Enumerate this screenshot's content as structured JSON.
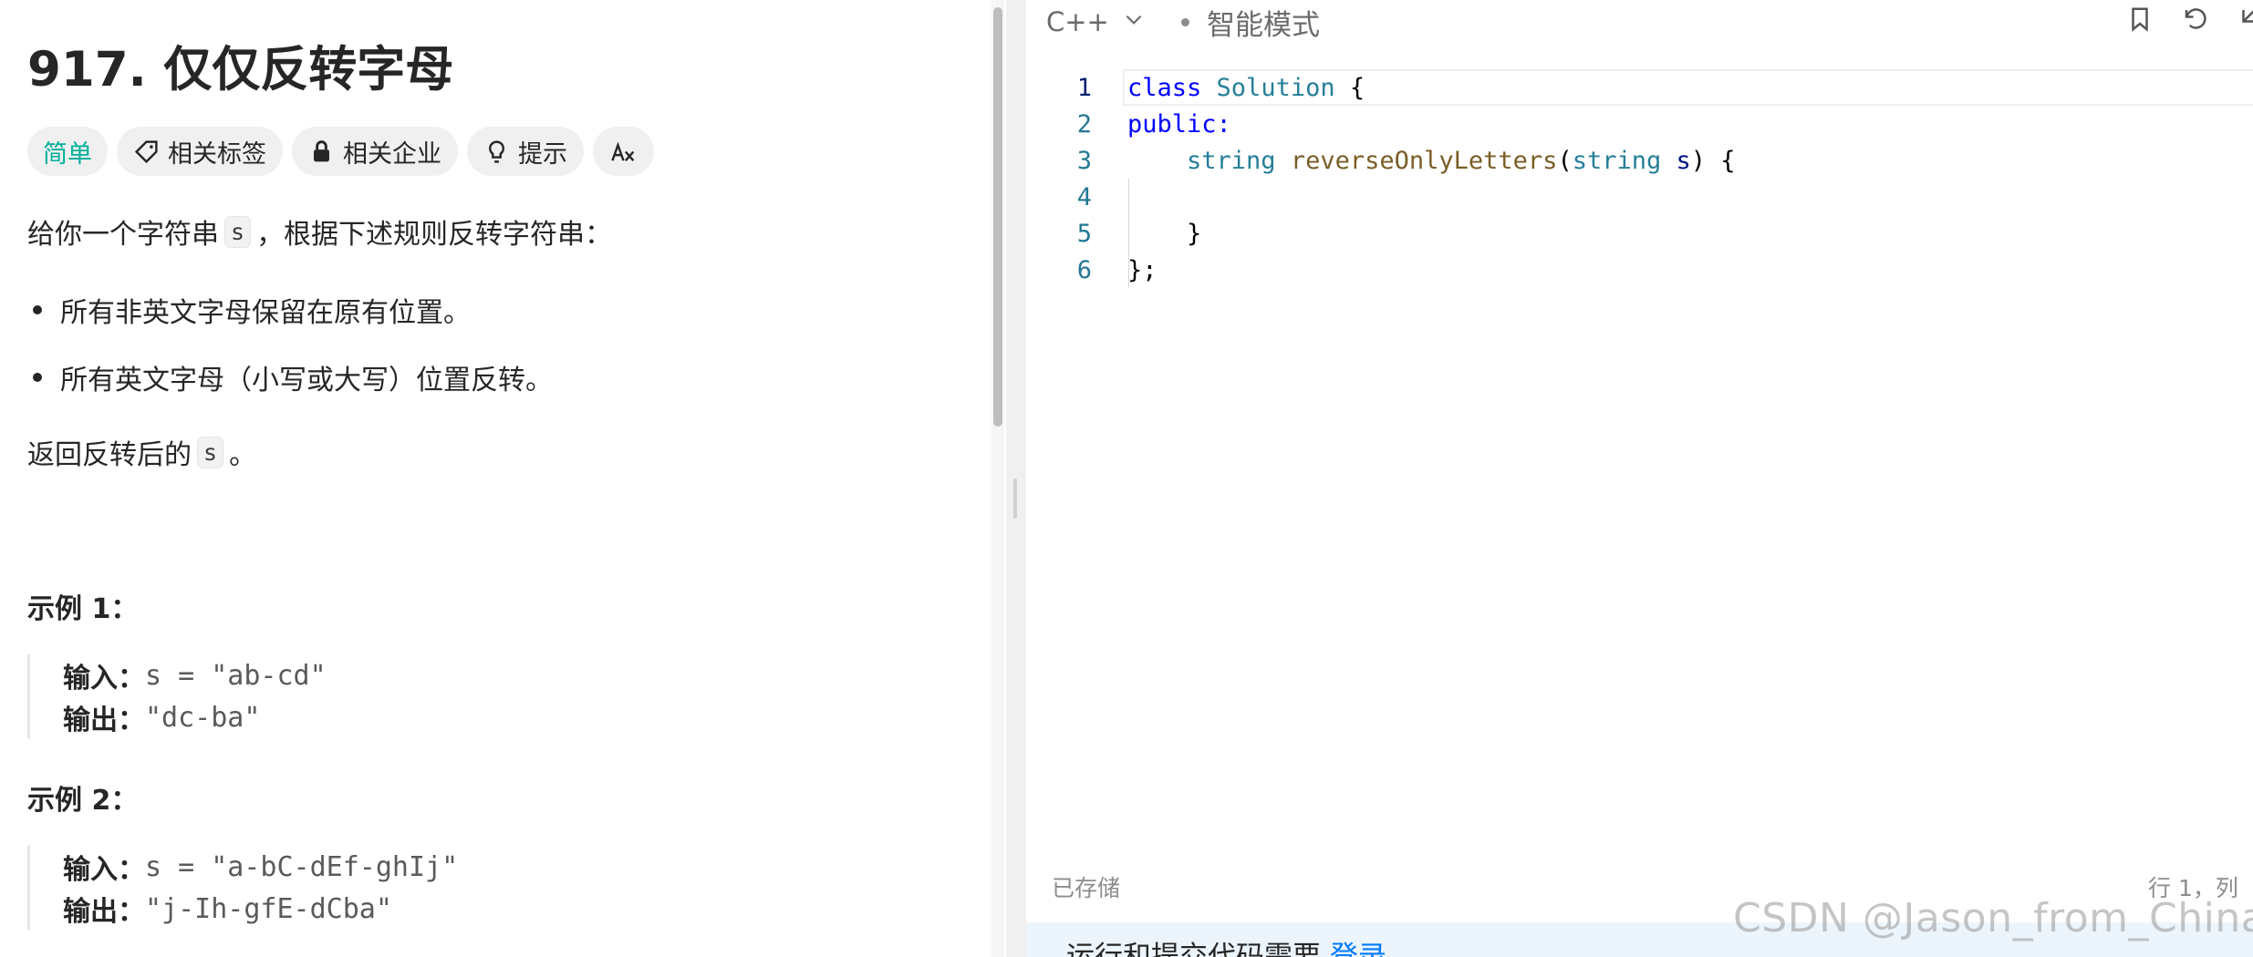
{
  "problem": {
    "title": "917. 仅仅反转字母",
    "tags": {
      "difficulty": "简单",
      "topics": "相关标签",
      "companies": "相关企业",
      "hint": "提示"
    },
    "description": {
      "p1_before": "给你一个字符串",
      "p1_code": "s",
      "p1_after": "，根据下述规则反转字符串：",
      "bullets": [
        "所有非英文字母保留在原有位置。",
        "所有英文字母（小写或大写）位置反转。"
      ],
      "p2_before": "返回反转后的",
      "p2_code": "s",
      "p2_after": "。"
    },
    "examples": [
      {
        "title": "示例 1：",
        "input_label": "输入：",
        "input": "s = \"ab-cd\"",
        "output_label": "输出：",
        "output": "\"dc-ba\""
      },
      {
        "title": "示例 2：",
        "input_label": "输入：",
        "input": "s = \"a-bC-dEf-ghIj\"",
        "output_label": "输出：",
        "output": "\"j-Ih-gfE-dCba\""
      }
    ]
  },
  "editor": {
    "language": "C++",
    "mode": "智能模式",
    "line_numbers": [
      "1",
      "2",
      "3",
      "4",
      "5",
      "6"
    ],
    "code": {
      "l1_kw": "class",
      "l1_ty": "Solution",
      "l1_rest": " {",
      "l2_kw": "public:",
      "l3_ty": "string",
      "l3_fn": "reverseOnlyLetters",
      "l3_p1": "(",
      "l3_ty2": "string",
      "l3_pm": "s",
      "l3_rest": ") {",
      "l5": "}",
      "l6": "};"
    },
    "status_saved": "已存储",
    "cursor_position": "行 1，列",
    "bottom_text": "运行和提交代码需要",
    "bottom_link": "登录"
  },
  "watermark": "CSDN @Jason_from_China",
  "colors": {
    "difficulty_easy": "#00af9b",
    "keyword": "#0000ff",
    "type": "#267f99",
    "function": "#795e26",
    "param": "#001080",
    "line_number": "#237893",
    "link": "#007aff"
  }
}
